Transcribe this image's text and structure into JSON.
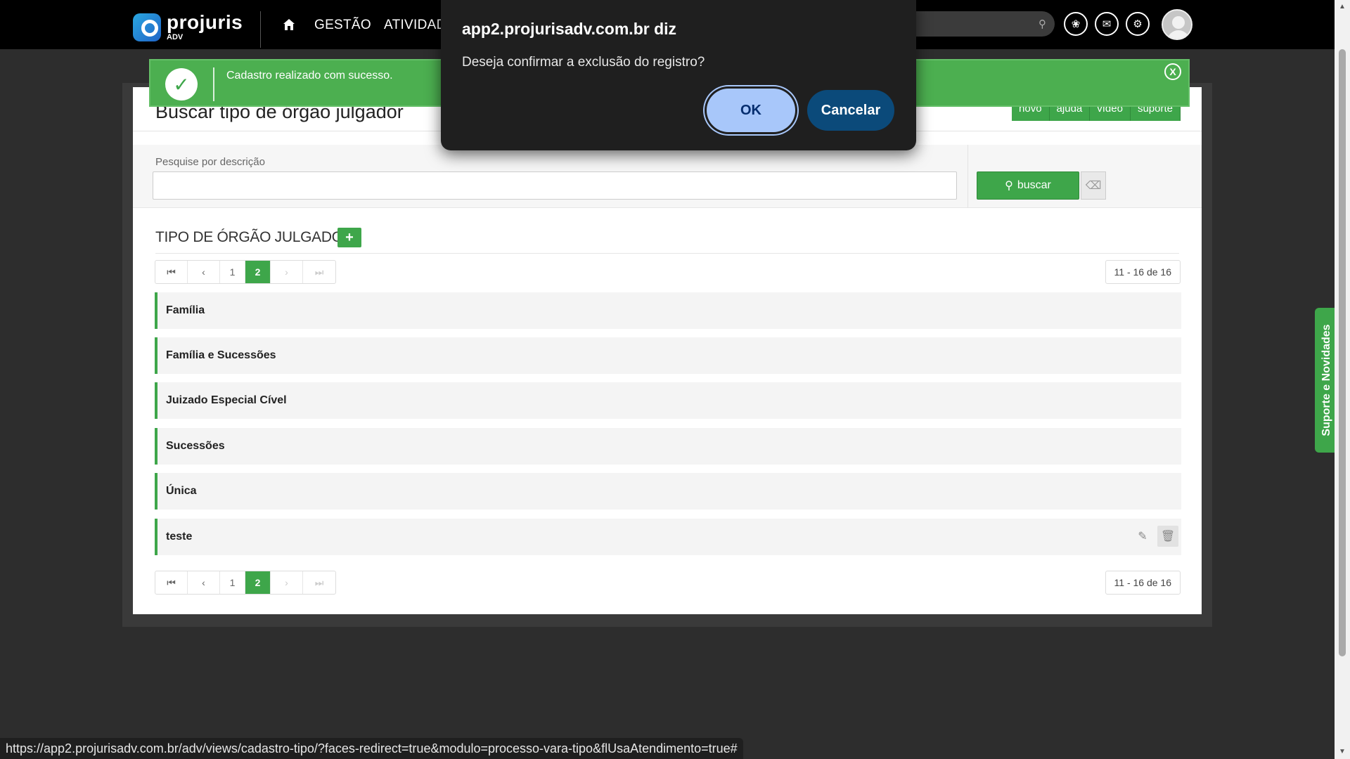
{
  "topbar": {
    "logo_name": "projuris",
    "logo_sub": "ADV",
    "nav_items": [
      "GESTÃO",
      "ATIVIDAD"
    ]
  },
  "page": {
    "title": "Buscar tipo de órgão julgador",
    "title_actions": [
      "novo",
      "ajuda",
      "vídeo",
      "suporte"
    ]
  },
  "search": {
    "label": "Pesquise por descrição",
    "value": "",
    "button_label": "buscar"
  },
  "list": {
    "title": "TIPO DE ÓRGÃO JULGADOR",
    "add_label": "+",
    "pages": [
      "1",
      "2"
    ],
    "current_page": "2",
    "range_text": "11 - 16 de 16",
    "items": [
      "Família",
      "Família e Sucessões",
      "Juizado Especial Cível",
      "Sucessões",
      "Única",
      "teste"
    ]
  },
  "toast": {
    "message": "Cadastro realizado com sucesso.",
    "close_label": "X"
  },
  "dialog": {
    "title": "app2.projurisadv.com.br diz",
    "message": "Deseja confirmar a exclusão do registro?",
    "ok_label": "OK",
    "cancel_label": "Cancelar"
  },
  "side_tab": {
    "label": "Suporte e Novidades"
  },
  "statusbar": {
    "url": "https://app2.projurisadv.com.br/adv/views/cadastro-tipo/?faces-redirect=true&modulo=processo-vara-tipo&flUsaAtendimento=true#"
  },
  "colors": {
    "accent_green": "#3ea64a",
    "toast_green": "#4caf50",
    "dialog_bg": "#1f1f1f",
    "ok_button": "#a8c7fa",
    "cancel_button": "#0b4a7a"
  },
  "icons": [
    "home-icon",
    "search-icon",
    "openai-icon",
    "mail-icon",
    "gear-icon",
    "avatar-icon",
    "check-icon",
    "close-icon",
    "edit-icon",
    "trash-icon",
    "eraser-icon"
  ]
}
